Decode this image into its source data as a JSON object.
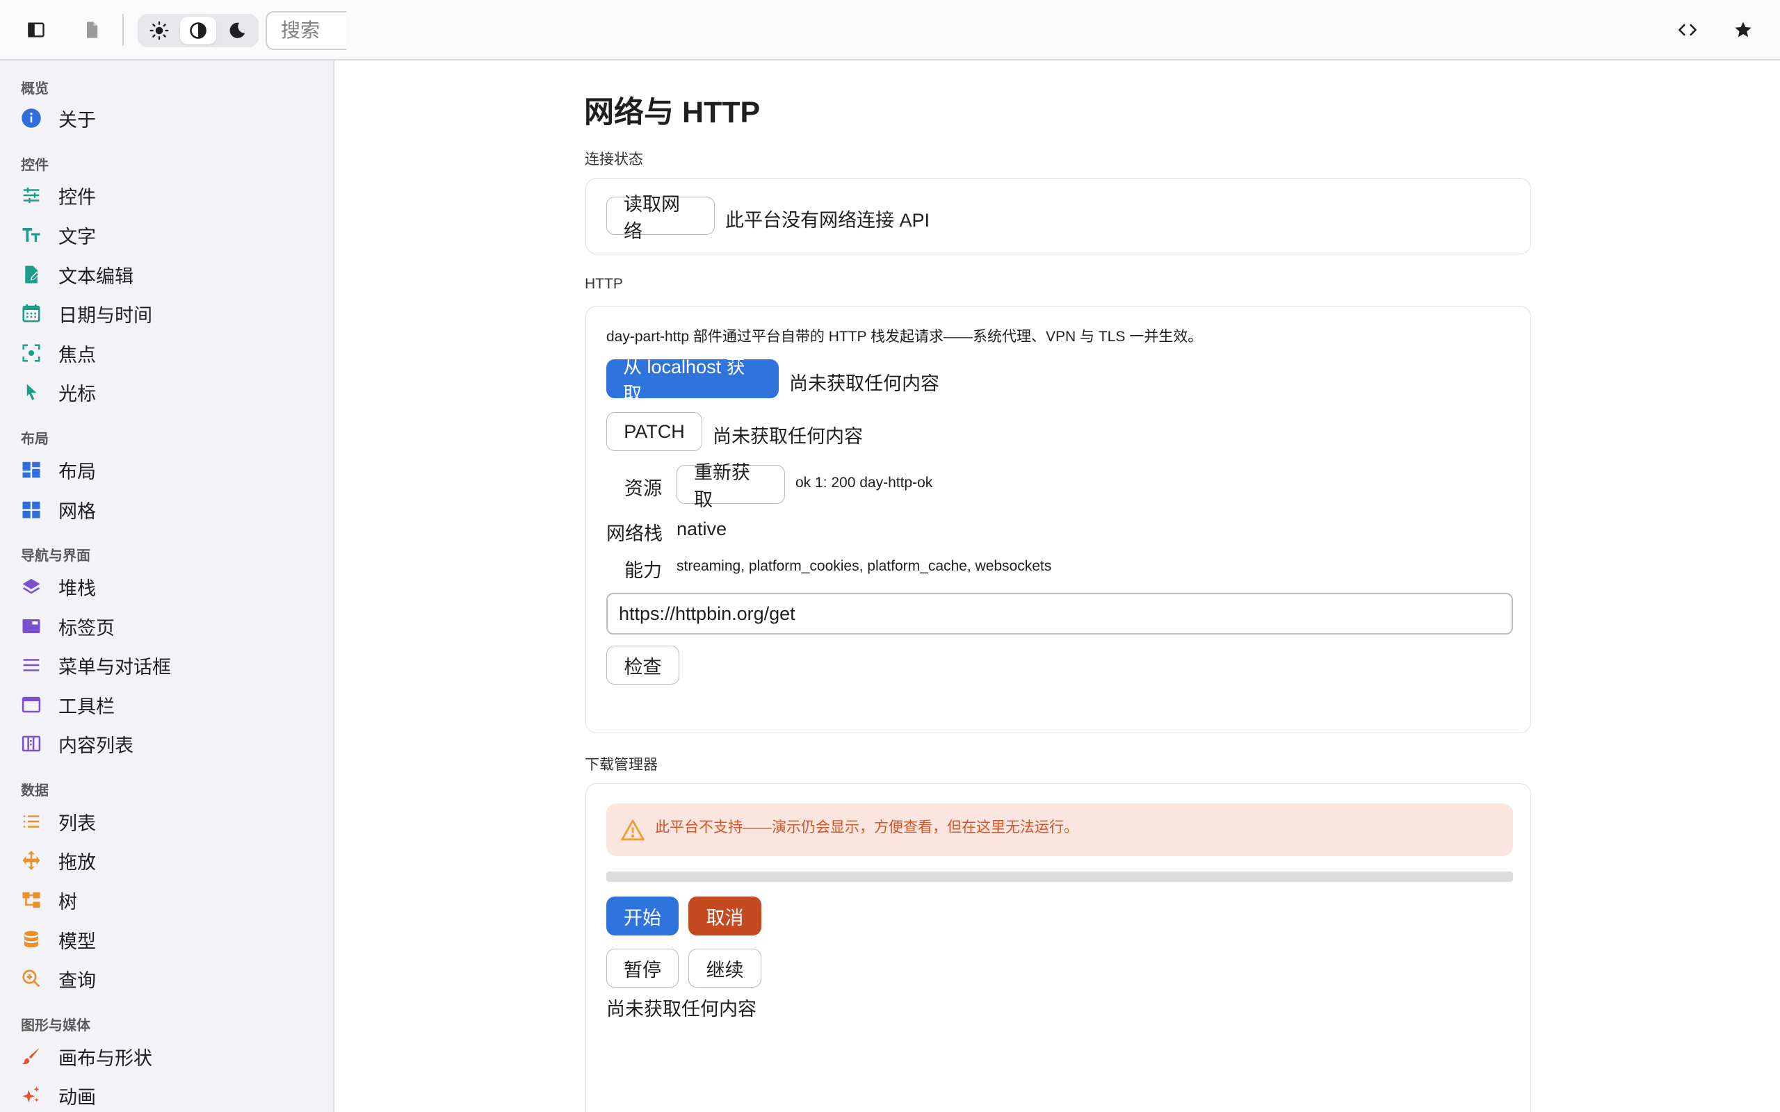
{
  "toolbar": {
    "sidebar_toggle_icon": "sidebar-icon",
    "file_icon": "document-icon",
    "theme_options": [
      "light",
      "auto",
      "dark"
    ],
    "theme_selected": "auto",
    "search_placeholder": "搜索",
    "code_icon": "code-icon",
    "favorite_icon": "star-icon"
  },
  "sidebar": {
    "sections": [
      {
        "title": "概览",
        "items": [
          {
            "label": "关于",
            "icon": "info-icon",
            "color": "#2f6fdc"
          }
        ]
      },
      {
        "title": "控件",
        "items": [
          {
            "label": "控件",
            "icon": "sliders-icon",
            "color": "#1e9c8a"
          },
          {
            "label": "文字",
            "icon": "text-size-icon",
            "color": "#1e9c8a"
          },
          {
            "label": "文本编辑",
            "icon": "edit-document-icon",
            "color": "#1e9c8a"
          },
          {
            "label": "日期与时间",
            "icon": "calendar-icon",
            "color": "#1e9c8a"
          },
          {
            "label": "焦点",
            "icon": "focus-icon",
            "color": "#1e9c8a"
          },
          {
            "label": "光标",
            "icon": "cursor-icon",
            "color": "#1e9c8a"
          }
        ]
      },
      {
        "title": "布局",
        "items": [
          {
            "label": "布局",
            "icon": "layout-icon",
            "color": "#2f6fdc"
          },
          {
            "label": "网格",
            "icon": "grid-icon",
            "color": "#2f6fdc"
          }
        ]
      },
      {
        "title": "导航与界面",
        "items": [
          {
            "label": "堆栈",
            "icon": "layers-icon",
            "color": "#7a52d0"
          },
          {
            "label": "标签页",
            "icon": "tab-icon",
            "color": "#7a52d0"
          },
          {
            "label": "菜单与对话框",
            "icon": "menu-icon",
            "color": "#7a52d0"
          },
          {
            "label": "工具栏",
            "icon": "window-icon",
            "color": "#7a52d0"
          },
          {
            "label": "内容列表",
            "icon": "columns-icon",
            "color": "#7a52d0"
          }
        ]
      },
      {
        "title": "数据",
        "items": [
          {
            "label": "列表",
            "icon": "list-icon",
            "color": "#e8912f"
          },
          {
            "label": "拖放",
            "icon": "move-icon",
            "color": "#e8912f"
          },
          {
            "label": "树",
            "icon": "tree-icon",
            "color": "#e8912f"
          },
          {
            "label": "模型",
            "icon": "database-icon",
            "color": "#e8912f"
          },
          {
            "label": "查询",
            "icon": "zoom-icon",
            "color": "#e8912f"
          }
        ]
      },
      {
        "title": "图形与媒体",
        "items": [
          {
            "label": "画布与形状",
            "icon": "brush-icon",
            "color": "#e0552a"
          },
          {
            "label": "动画",
            "icon": "sparkle-icon",
            "color": "#e0552a"
          }
        ]
      }
    ]
  },
  "main": {
    "title": "网络与 HTTP",
    "connection": {
      "label": "连接状态",
      "read_button": "读取网络",
      "status_text": "此平台没有网络连接 API"
    },
    "http": {
      "label": "HTTP",
      "description": "day-part-http 部件通过平台自带的 HTTP 栈发起请求——系统代理、VPN 与 TLS 一并生效。",
      "fetch_button": "从 localhost 获取",
      "fetch_result": "尚未获取任何内容",
      "patch_button": "PATCH",
      "patch_result": "尚未获取任何内容",
      "resource_label": "资源",
      "refetch_button": "重新获取",
      "resource_result": "ok 1: 200 day-http-ok",
      "stack_label": "网络栈",
      "stack_value": "native",
      "capability_label": "能力",
      "capability_value": "streaming, platform_cookies, platform_cache, websockets",
      "url_value": "https://httpbin.org/get",
      "check_button": "检查"
    },
    "download": {
      "label": "下载管理器",
      "warning": "此平台不支持——演示仍会显示，方便查看，但在这里无法运行。",
      "progress": 0,
      "start_button": "开始",
      "cancel_button": "取消",
      "pause_button": "暂停",
      "resume_button": "继续",
      "status": "尚未获取任何内容"
    }
  },
  "colors": {
    "primary": "#2f73dc",
    "danger": "#c54a22",
    "warning_bg": "#fbe6df",
    "warning_text": "#d3542a"
  }
}
